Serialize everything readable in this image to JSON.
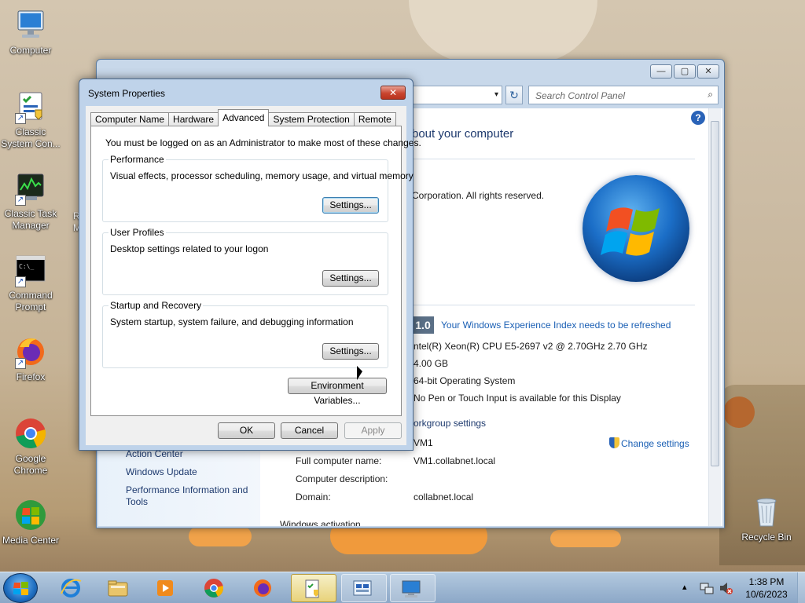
{
  "desktop": {
    "icons": [
      {
        "label": "Computer"
      },
      {
        "label": "Classic System Con..."
      },
      {
        "label": "Classic Task Manager"
      },
      {
        "label": "Command Prompt"
      },
      {
        "label": "Firefox"
      },
      {
        "label": "Google Chrome"
      },
      {
        "label": "Media Center"
      },
      {
        "label": "Recycle Bin"
      }
    ],
    "partial_icon_letters": [
      "R",
      "M"
    ]
  },
  "control_panel": {
    "caption_buttons": {
      "minimize": "—",
      "maximize": "▢",
      "close": "✕"
    },
    "address_dropdown": "▾",
    "refresh_glyph": "↻",
    "search_placeholder": "Search Control Panel",
    "search_icon": "⌕",
    "help_glyph": "?",
    "title": "bout your computer",
    "copyright": "Corporation.  All rights reserved.",
    "sidebar_links": [
      "Action Center",
      "Windows Update",
      "Performance Information and Tools"
    ],
    "score": "1.0",
    "experience_link": "Your Windows Experience Index needs to be refreshed",
    "processor": "ntel(R) Xeon(R) CPU E5-2697 v2 @ 2.70GHz   2.70 GHz",
    "memory": "4.00 GB",
    "system_type": "64-bit Operating System",
    "pen_touch": "No Pen or Touch Input is available for this Display",
    "workgroup_heading": "orkgroup settings",
    "computer_name": "VM1",
    "change_settings": "Change settings",
    "full_name_label": "Full computer name:",
    "full_name_value": "VM1.collabnet.local",
    "description_label": "Computer description:",
    "domain_label": "Domain:",
    "domain_value": "collabnet.local",
    "activation_partial": "Windows activation"
  },
  "dialog": {
    "title": "System Properties",
    "close_glyph": "✕",
    "tabs": [
      "Computer Name",
      "Hardware",
      "Advanced",
      "System Protection",
      "Remote"
    ],
    "active_tab": "Advanced",
    "admin_note": "You must be logged on as an Administrator to make most of these changes.",
    "performance": {
      "label": "Performance",
      "description": "Visual effects, processor scheduling, memory usage, and virtual memory",
      "button": "Settings..."
    },
    "user_profiles": {
      "label": "User Profiles",
      "description": "Desktop settings related to your logon",
      "button": "Settings..."
    },
    "startup": {
      "label": "Startup and Recovery",
      "description": "System startup, system failure, and debugging information",
      "button": "Settings..."
    },
    "env_button": "Environment Variables...",
    "ok": "OK",
    "cancel": "Cancel",
    "apply": "Apply"
  },
  "taskbar": {
    "items": [
      "start-button",
      "internet-explorer",
      "windows-explorer",
      "media-player",
      "google-chrome",
      "firefox",
      "control-panel",
      "system-properties",
      "computer"
    ],
    "tray_expand": "▴",
    "time": "1:38 PM",
    "date": "10/6/2023"
  }
}
